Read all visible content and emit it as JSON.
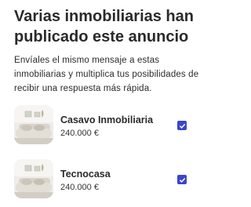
{
  "header": {
    "title": "Varias inmobiliarias han publicado este anuncio",
    "description": "Envíales el mismo mensaje a estas inmobiliarias y multiplica tus posibilidades de recibir una respuesta más rápida."
  },
  "agencies": [
    {
      "name": "Casavo Inmobiliaria",
      "price": "240.000 €",
      "selected": true,
      "icon": "property-photo"
    },
    {
      "name": "Tecnocasa",
      "price": "240.000 €",
      "selected": true,
      "icon": "property-photo"
    }
  ],
  "colors": {
    "accent": "#3a46c8",
    "text": "#2a2a2a"
  }
}
